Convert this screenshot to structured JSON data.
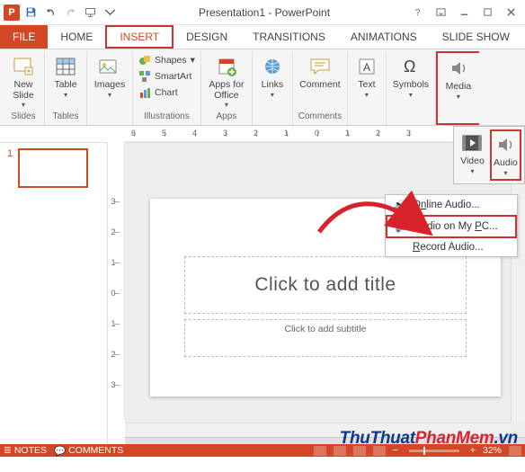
{
  "title": "Presentation1 - PowerPoint",
  "tabs": {
    "file": "FILE",
    "home": "HOME",
    "insert": "INSERT",
    "design": "DESIGN",
    "transitions": "TRANSITIONS",
    "animations": "ANIMATIONS",
    "slideshow": "SLIDE SHOW"
  },
  "ribbon": {
    "slides": {
      "new_slide": "New\nSlide",
      "group": "Slides"
    },
    "tables": {
      "table": "Table",
      "group": "Tables"
    },
    "images": {
      "images": "Images",
      "group": " "
    },
    "illus": {
      "shapes": "Shapes",
      "smartart": "SmartArt",
      "chart": "Chart",
      "group": "Illustrations"
    },
    "apps": {
      "apps": "Apps for\nOffice",
      "group": "Apps"
    },
    "links": {
      "links": "Links",
      "group": " "
    },
    "comments": {
      "comment": "Comment",
      "group": "Comments"
    },
    "text": {
      "text": "Text",
      "group": " "
    },
    "symbols": {
      "symbols": "Symbols",
      "group": " "
    },
    "media": {
      "media": "Media",
      "group": " "
    }
  },
  "flyout": {
    "video": "Video",
    "audio": "Audio"
  },
  "audio_menu": {
    "online": {
      "pre": "O",
      "ul": "n",
      "post": "line Audio..."
    },
    "mypc": {
      "pre": "Audio on My ",
      "ul": "P",
      "post": "C..."
    },
    "record": {
      "pre": "",
      "ul": "R",
      "post": "ecord Audio..."
    }
  },
  "thumb": {
    "num": "1"
  },
  "slide": {
    "title": "Click to add title",
    "subtitle": "Click to add subtitle"
  },
  "ruler_h": [
    "6",
    "5",
    "4",
    "3",
    "2",
    "1",
    "0",
    "1",
    "2",
    "3"
  ],
  "ruler_v": [
    "3",
    "2",
    "1",
    "0",
    "1",
    "2",
    "3"
  ],
  "status": {
    "notes": "NOTES",
    "comments": "COMMENTS",
    "zoom": "32%"
  },
  "watermark": {
    "part1": "ThuThuat",
    "part2": "PhanMem",
    "part3": ".vn"
  }
}
